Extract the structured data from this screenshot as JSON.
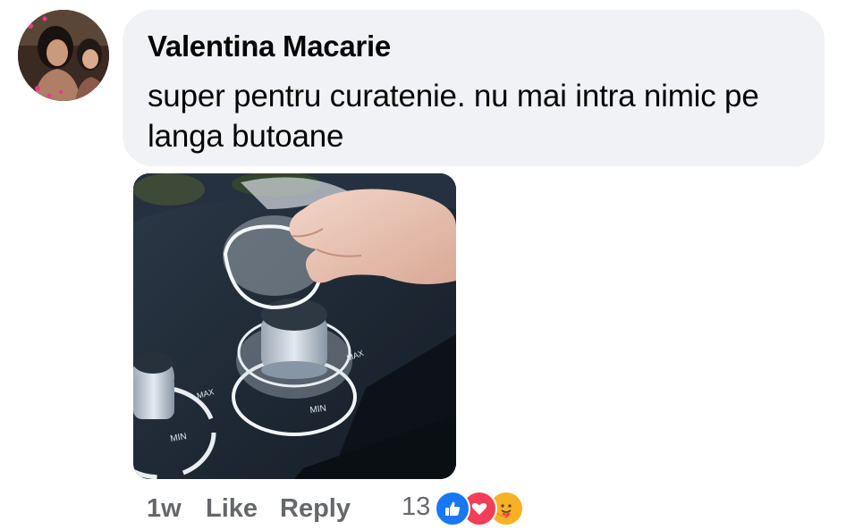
{
  "comment": {
    "author": "Valentina Macarie",
    "text": "super pentru curatenie. nu mai intra nimic pe langa butoane",
    "time": "1w",
    "like_label": "Like",
    "reply_label": "Reply",
    "reaction_count": "13",
    "reactions": [
      "like-icon",
      "love-icon",
      "care-icon"
    ]
  },
  "colors": {
    "bubble_bg": "#f0f2f5",
    "meta_text": "#65676b",
    "like_blue": "#1877f2",
    "love_red": "#f33e58",
    "care_yellow": "#f7b125"
  }
}
